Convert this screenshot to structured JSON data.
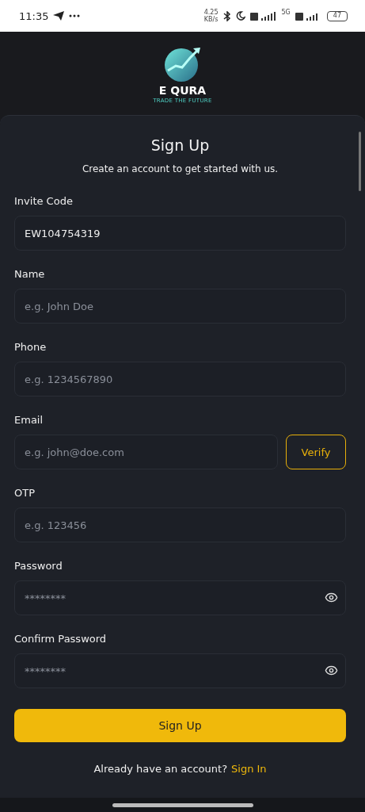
{
  "status_bar": {
    "time": "11:35",
    "speed_value": "4.25",
    "speed_unit": "KB/s",
    "network": "5G",
    "battery": "47"
  },
  "logo": {
    "name": "E QURA",
    "tagline": "TRADE THE FUTURE"
  },
  "form": {
    "title": "Sign Up",
    "subtitle": "Create an account to get started with us.",
    "fields": [
      {
        "kind": "text",
        "label": "Invite Code",
        "value": "EW104754319"
      },
      {
        "kind": "text",
        "label": "Name",
        "placeholder": "e.g. John Doe"
      },
      {
        "kind": "text",
        "label": "Phone",
        "placeholder": "e.g. 1234567890"
      },
      {
        "kind": "verify",
        "label": "Email",
        "placeholder": "e.g. john@doe.com",
        "button": "Verify"
      },
      {
        "kind": "text",
        "label": "OTP",
        "placeholder": "e.g. 123456"
      },
      {
        "kind": "password",
        "label": "Password",
        "placeholder": "********"
      },
      {
        "kind": "password",
        "label": "Confirm Password",
        "placeholder": "********"
      }
    ],
    "submit": "Sign Up",
    "footer_text": "Already have an account?",
    "footer_link": "Sign In"
  }
}
